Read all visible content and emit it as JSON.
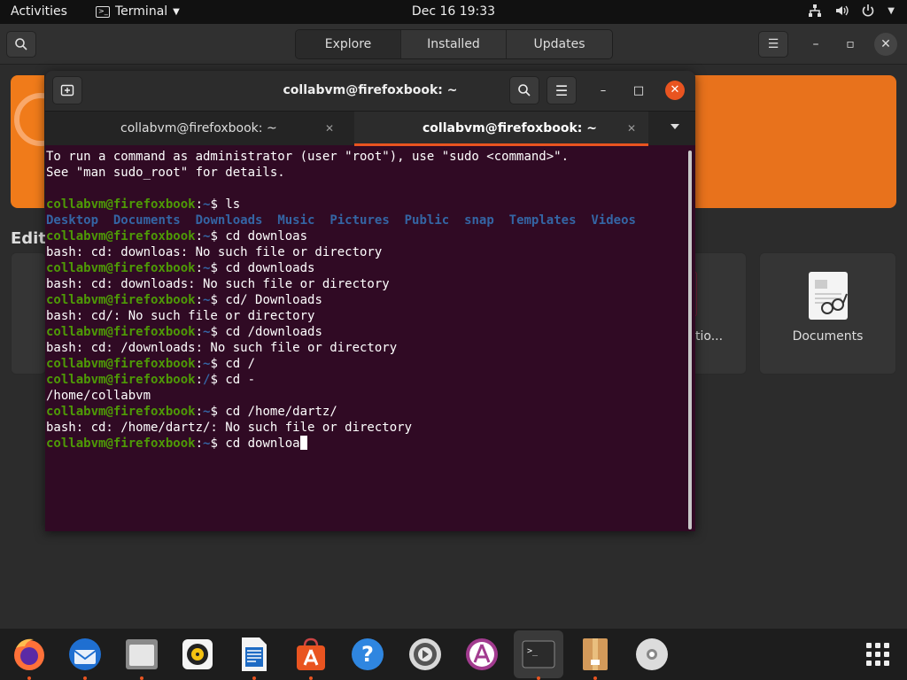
{
  "topbar": {
    "activities": "Activities",
    "app_name": "Terminal",
    "clock": "Dec 16  19:33"
  },
  "software": {
    "tabs": [
      "Explore",
      "Installed",
      "Updates"
    ],
    "active_tab": "Explore",
    "section_label": "Edito",
    "card_partial_label": "tio...",
    "card_documents_label": "Documents"
  },
  "terminal": {
    "title": "collabvm@firefoxbook: ~",
    "tabs": [
      {
        "label": "collabvm@firefoxbook: ~",
        "active": false
      },
      {
        "label": "collabvm@firefoxbook: ~",
        "active": true
      }
    ],
    "lines": [
      {
        "text": "To run a command as administrator (user \"root\"), use \"sudo <command>\"."
      },
      {
        "text": "See \"man sudo_root\" for details."
      },
      {
        "text": ""
      },
      {
        "prompt": "collabvm@firefoxbook",
        "path": "~",
        "cmd": " ls"
      },
      {
        "dirs": [
          "Desktop",
          "Documents",
          "Downloads",
          "Music",
          "Pictures",
          "Public",
          "snap",
          "Templates",
          "Videos"
        ]
      },
      {
        "prompt": "collabvm@firefoxbook",
        "path": "~",
        "cmd": " cd downloas"
      },
      {
        "text": "bash: cd: downloas: No such file or directory"
      },
      {
        "prompt": "collabvm@firefoxbook",
        "path": "~",
        "cmd": " cd downloads"
      },
      {
        "text": "bash: cd: downloads: No such file or directory"
      },
      {
        "prompt": "collabvm@firefoxbook",
        "path": "~",
        "cmd": " cd/ Downloads"
      },
      {
        "text": "bash: cd/: No such file or directory"
      },
      {
        "prompt": "collabvm@firefoxbook",
        "path": "~",
        "cmd": " cd /downloads"
      },
      {
        "text": "bash: cd: /downloads: No such file or directory"
      },
      {
        "prompt": "collabvm@firefoxbook",
        "path": "~",
        "cmd": " cd /"
      },
      {
        "prompt": "collabvm@firefoxbook",
        "path": "/",
        "cmd": " cd -"
      },
      {
        "text": "/home/collabvm"
      },
      {
        "prompt": "collabvm@firefoxbook",
        "path": "~",
        "cmd": " cd /home/dartz/"
      },
      {
        "text": "bash: cd: /home/dartz/: No such file or directory"
      },
      {
        "prompt": "collabvm@firefoxbook",
        "path": "~",
        "cmd": " cd downloa",
        "cursor": true
      }
    ]
  },
  "dock": {
    "items": [
      {
        "name": "firefox-icon",
        "running": true
      },
      {
        "name": "thunderbird-icon",
        "running": true
      },
      {
        "name": "files-icon",
        "running": true
      },
      {
        "name": "rhythmbox-icon",
        "running": false
      },
      {
        "name": "libreoffice-writer-icon",
        "running": true
      },
      {
        "name": "ubuntu-software-icon",
        "running": true
      },
      {
        "name": "help-icon",
        "running": false
      },
      {
        "name": "settings-icon",
        "running": false
      },
      {
        "name": "app-center-icon",
        "running": false
      },
      {
        "name": "terminal-icon",
        "running": true
      },
      {
        "name": "archive-icon",
        "running": true
      },
      {
        "name": "disc-icon",
        "running": false
      }
    ],
    "show_apps": "show-applications-icon"
  },
  "colors": {
    "terminal_bg": "#300a24",
    "prompt_green": "#4e9a06",
    "dir_blue": "#3465a4",
    "accent": "#e95420"
  }
}
